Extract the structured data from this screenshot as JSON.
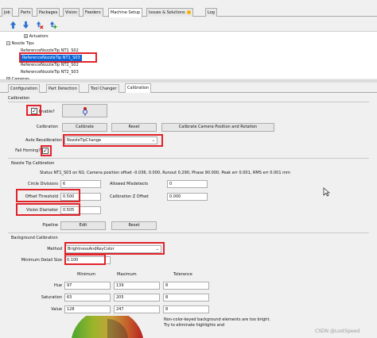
{
  "main_tabs": [
    {
      "label": "Job"
    },
    {
      "label": "Parts"
    },
    {
      "label": "Packages"
    },
    {
      "label": "Vision"
    },
    {
      "label": "Feeders"
    },
    {
      "label": "Machine Setup"
    },
    {
      "label": "Issues & Solutions"
    },
    {
      "label": "Log"
    }
  ],
  "tree": {
    "actuators": "Actuators",
    "nozzle_tips": "Nozzle Tips",
    "items": [
      "ReferenceNozzleTip NT1_S02",
      "ReferenceNozzleTip NT1_S03",
      "ReferenceNozzleTip NT2_S02",
      "ReferenceNozzleTip NT2_S03"
    ],
    "cameras": "Cameras"
  },
  "sub_tabs": [
    {
      "label": "Configuration"
    },
    {
      "label": "Part Detection"
    },
    {
      "label": "Tool Changer"
    },
    {
      "label": "Calibration"
    }
  ],
  "calibration": {
    "section_title": "Calibration",
    "enable_label": "Enable?",
    "calibration_label": "Calibration",
    "calibrate_button": "Calibrate",
    "reset_button": "Reset",
    "camera_button": "Calibrate Camera Position and Rotation",
    "auto_recal_label": "Auto Recalibration",
    "auto_recal_value": "NozzleTipChange",
    "fail_homing_label": "Fail Homing?"
  },
  "nozzle_cal": {
    "section_title": "Nozzle Tip Calibration",
    "status": "Status NT1_S03 on N1: Camera position offset -0.036, 0.000, Runout 0.290, Phase 90.000, Peak err 0.001, RMS err 0.001 mm",
    "circle_divisions_label": "Circle Divisions",
    "circle_divisions_value": "6",
    "allowed_misdetects_label": "Allowed Misdetects",
    "allowed_misdetects_value": "0",
    "offset_threshold_label": "Offset Threshold",
    "offset_threshold_value": "0.500",
    "cal_z_offset_label": "Calibration Z Offset",
    "cal_z_offset_value": "0.000",
    "vision_diameter_label": "Vision Diameter",
    "vision_diameter_value": "0.505",
    "pipeline_label": "Pipeline",
    "edit_button": "Edit",
    "reset_button": "Reset"
  },
  "background": {
    "section_title": "Background Calibration",
    "method_label": "Method",
    "method_value": "BrightnessAndKeyColor",
    "min_detail_label": "Minimum Detail Size",
    "min_detail_value": "0.100",
    "col_minimum": "Minimum",
    "col_maximum": "Maximum",
    "col_tolerance": "Tolerance",
    "rows": [
      {
        "label": "Hue",
        "min": "97",
        "max": "139",
        "tol": "8"
      },
      {
        "label": "Saturation",
        "min": "63",
        "max": "205",
        "tol": "8"
      },
      {
        "label": "Value",
        "min": "128",
        "max": "247",
        "tol": "8"
      }
    ],
    "note": "Non-color-keyed background elements are too bright.\nTry to eliminate highlights and"
  },
  "watermark": "CSDN @LostSpeed",
  "colors": {
    "highlight_red": "#e0242a",
    "selection_blue": "#0a64d6"
  }
}
